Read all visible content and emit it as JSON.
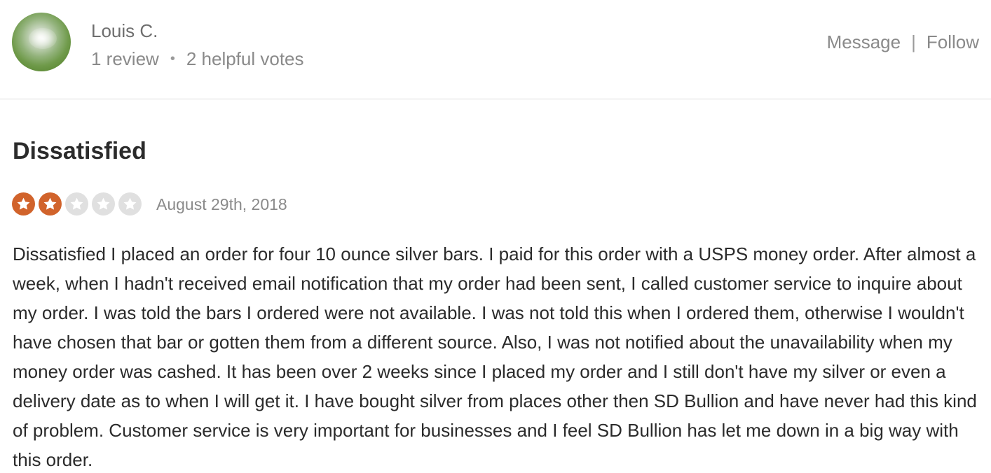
{
  "reviewer": {
    "name": "Louis C.",
    "reviews": "1 review",
    "helpful_votes": "2 helpful votes",
    "separator": "•"
  },
  "actions": {
    "message_label": "Message",
    "divider": "|",
    "follow_label": "Follow"
  },
  "review": {
    "title": "Dissatisfied",
    "rating": 2,
    "max_rating": 5,
    "date": "August 29th, 2018",
    "body": "Dissatisfied I placed an order for four 10 ounce silver bars. I paid for this order with a USPS money order. After almost a week, when I hadn't received email notification that my order had been sent, I called customer service to inquire about my order. I was told the bars I ordered were not available. I was not told this when I ordered them, otherwise I wouldn't have chosen that bar or gotten them from a different source. Also, I was not notified about the unavailability when my money order was cashed. It has been over 2 weeks since I placed my order and I still don't have my silver or even a delivery date as to when I will get it. I have bought silver from places other then SD Bullion and have never had this kind of problem. Customer service is very important for businesses and I feel SD Bullion has let me down in a big way with this order."
  },
  "colors": {
    "star_filled": "#d1632b",
    "star_empty": "#e0e0e0"
  },
  "icons": {
    "avatar": "reviewer-avatar",
    "star": "star-icon"
  }
}
